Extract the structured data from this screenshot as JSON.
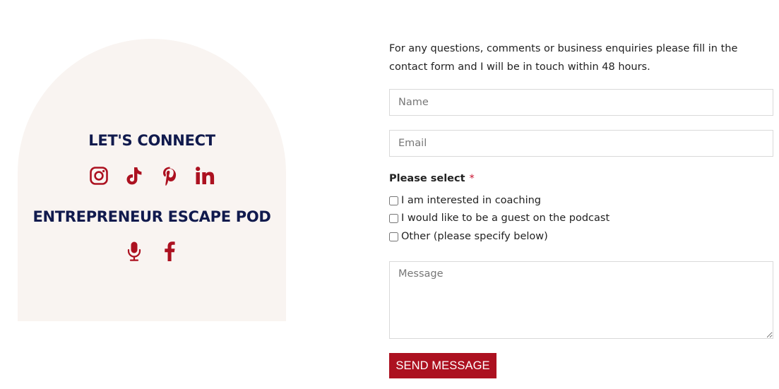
{
  "left_panel": {
    "connect_heading": "LET'S CONNECT",
    "social_icons": [
      "instagram-icon",
      "tiktok-icon",
      "pinterest-icon",
      "linkedin-icon"
    ],
    "podcast_heading": "ENTREPRENEUR ESCAPE POD",
    "podcast_icons": [
      "microphone-icon",
      "facebook-icon"
    ]
  },
  "form": {
    "intro": "For any questions, comments or business enquiries please fill in the contact form and I will be in touch within 48 hours.",
    "name_placeholder": "Name",
    "email_placeholder": "Email",
    "select_label": "Please select",
    "required_mark": "*",
    "options": [
      {
        "label": "I am interested in coaching",
        "checked": false
      },
      {
        "label": "I would like to be a guest on the podcast",
        "checked": false
      },
      {
        "label": "Other (please specify below)",
        "checked": false
      }
    ],
    "message_placeholder": "Message",
    "submit_label": "SEND MESSAGE"
  },
  "colors": {
    "accent": "#ac1120",
    "heading": "#111a4d",
    "panel_bg": "#f9f4f1"
  }
}
